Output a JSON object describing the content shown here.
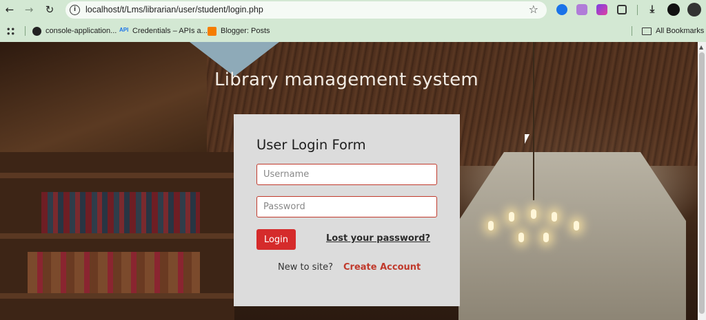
{
  "browser": {
    "url": "localhost/t/Lms/librarian/user/student/login.php",
    "nav": {
      "back": "←",
      "forward": "→",
      "reload": "↻"
    },
    "info_icon": "i",
    "bookmark_star": "☆",
    "extensions": [
      "wappalyzer-icon",
      "m-extension-icon",
      "colorful-extension-icon",
      "puzzle-icon"
    ],
    "bookmarks": [
      {
        "icon": "github-icon",
        "label": "console-application..."
      },
      {
        "icon": "api-icon",
        "label": "Credentials – APIs a..."
      },
      {
        "icon": "blogger-icon",
        "label": "Blogger: Posts"
      }
    ],
    "all_bookmarks": "All Bookmarks",
    "api_badge": "API"
  },
  "page": {
    "site_title": "Library management system",
    "form": {
      "title": "User Login Form",
      "username_placeholder": "Username",
      "password_placeholder": "Password",
      "login_label": "Login",
      "lost_password": "Lost your password?",
      "new_to_site": "New to site?",
      "create_account": "Create Account"
    }
  },
  "colors": {
    "chrome_bg": "#d3e8d3",
    "card_bg": "#dcdcdc",
    "accent_red": "#d52b2b",
    "link_red": "#c0392b"
  }
}
